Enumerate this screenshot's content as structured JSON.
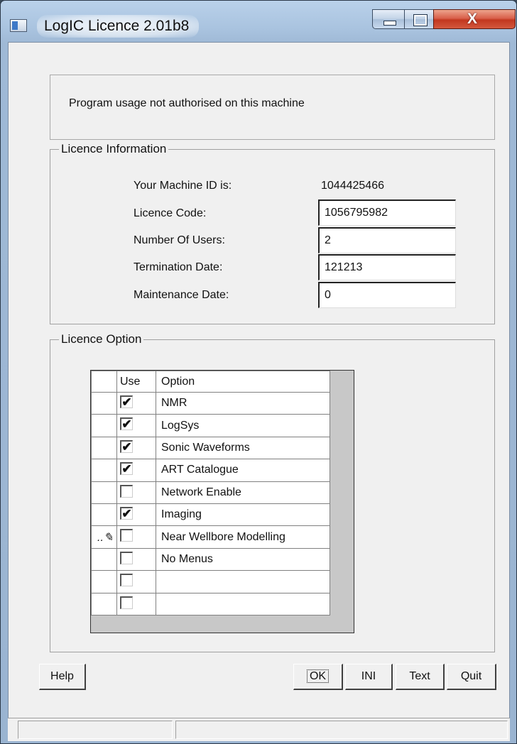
{
  "window": {
    "title": "LogIC Licence 2.01b8",
    "app_icon": "window-icon",
    "controls": {
      "minimize": "minimize-icon",
      "maximize": "maximize-icon",
      "close_label": "X"
    }
  },
  "message": "Program usage not authorised on this machine",
  "licence_info": {
    "legend": "Licence Information",
    "machine_id_label": "Your Machine ID is:",
    "machine_id_value": "1044425466",
    "licence_code_label": "Licence Code:",
    "licence_code_value": "1056795982",
    "users_label": "Number Of Users:",
    "users_value": "2",
    "termination_label": "Termination Date:",
    "termination_value": "121213",
    "maintenance_label": "Maintenance Date:",
    "maintenance_value": "0"
  },
  "licence_option": {
    "legend": "Licence Option",
    "columns": {
      "use": "Use",
      "option": "Option"
    },
    "rows": [
      {
        "name": "NMR",
        "checked": true,
        "editing": false
      },
      {
        "name": "LogSys",
        "checked": true,
        "editing": false
      },
      {
        "name": "Sonic Waveforms",
        "checked": true,
        "editing": false
      },
      {
        "name": "ART Catalogue",
        "checked": true,
        "editing": false
      },
      {
        "name": "Network Enable",
        "checked": false,
        "editing": false
      },
      {
        "name": "Imaging",
        "checked": true,
        "editing": false
      },
      {
        "name": "Near Wellbore Modelling",
        "checked": false,
        "editing": true
      },
      {
        "name": "No Menus",
        "checked": false,
        "editing": false
      },
      {
        "name": "",
        "checked": false,
        "editing": false
      },
      {
        "name": "",
        "checked": false,
        "editing": false
      }
    ]
  },
  "buttons": {
    "help": "Help",
    "ok": "OK",
    "ini": "INI",
    "text": "Text",
    "quit": "Quit"
  },
  "status": {
    "pane1": "",
    "pane2": ""
  }
}
